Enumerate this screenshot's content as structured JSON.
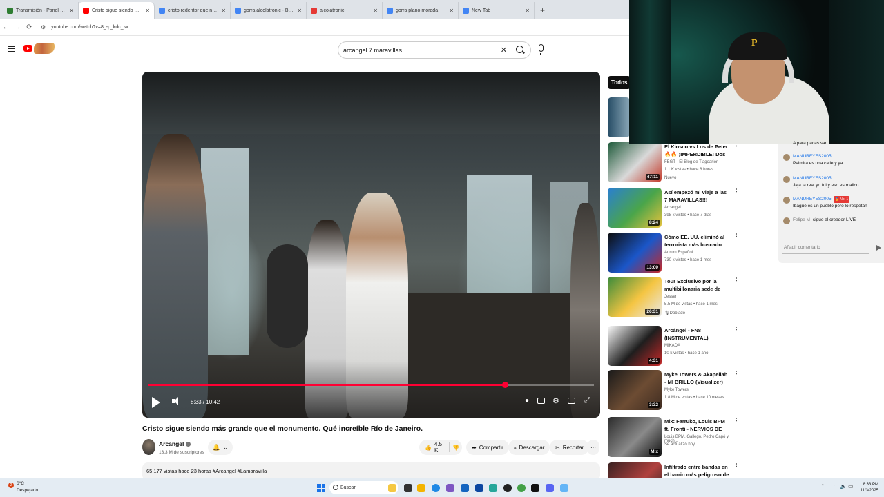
{
  "browser": {
    "tabs": [
      {
        "label": "Transmisión - Panel de control",
        "color": "#2e7d32",
        "active": false
      },
      {
        "label": "Cristo sigue siendo más gra",
        "color": "#ff0000",
        "active": true
      },
      {
        "label": "cristo redentor que numero de",
        "color": "#4285f4",
        "active": false
      },
      {
        "label": "gorra alcolatronic - Buscar con",
        "color": "#4285f4",
        "active": false
      },
      {
        "label": "alcolatronic",
        "color": "#e53935",
        "active": false
      },
      {
        "label": "gorra plano morada",
        "color": "#4285f4",
        "active": false
      },
      {
        "label": "New Tab",
        "color": "#4285f4",
        "active": false
      }
    ],
    "new_tab_symbol": "+",
    "url": "youtube.com/watch?v=8_-p_kdc_lw"
  },
  "header": {
    "search_query": "arcangel 7 maravillas"
  },
  "player": {
    "time": "8:33 / 10:42",
    "progress_fraction": 0.8
  },
  "video": {
    "title": "Cristo sigue siendo más grande que el monumento. Qué increíble Río de Janeiro.",
    "channel": "Arcangel",
    "subscribers": "13.3 M de suscriptores",
    "likes": "4.5 K",
    "share_label": "Compartir",
    "download_label": "Descargar",
    "clip_label": "Recortar",
    "more_label": "···",
    "description": "65,177 vistas  hace 23 horas  #Arcangel #Lamaravilla"
  },
  "sidebar": {
    "chip": "Todos",
    "items": [
      {
        "title": "El Kiosco vs Los de Peter 🔥🔥 ¡IMPERDIBLE! Dos ...",
        "channel": "FBGT - El Blog de Tiagoariori",
        "meta": "1.1 K vistas • hace 8 horas",
        "badge": "Nuevo",
        "duration": "47:11",
        "thumb": [
          "#1e5a3a",
          "#d9d9d9",
          "#c43a2a"
        ]
      },
      {
        "title": "Así empezó mi viaje a las 7 MARAVILLAS!!!",
        "channel": "Arcangel",
        "meta": "398 k vistas • hace 7 días",
        "badge": "",
        "duration": "8:24",
        "thumb": [
          "#2a7fd1",
          "#4aa54a",
          "#e7c23d"
        ]
      },
      {
        "title": "Cómo EE. UU. eliminó al terrorista más buscado del ...",
        "channel": "Aurum Español",
        "meta": "730 k vistas • hace 1 mes",
        "badge": "",
        "duration": "13:00",
        "thumb": [
          "#0d0d0d",
          "#1b57c9",
          "#c62828"
        ]
      },
      {
        "title": "Tour Exclusivo por la multibillonaria sede de Nike",
        "channel": "Jesser",
        "meta": "5.5 M de vistas • hace 1 mes",
        "badge": "🎙Doblado",
        "duration": "26:31",
        "thumb": [
          "#3b8b3b",
          "#f5c542",
          "#e9e9e9"
        ]
      },
      {
        "title": "Arcángel - FN8 (INSTRUMENTAL)",
        "channel": "MIKADA",
        "meta": "10 k vistas • hace 1 año",
        "badge": "",
        "duration": "4:31",
        "thumb": [
          "#fafafa",
          "#1e1e1e",
          "#c62828"
        ]
      },
      {
        "title": "Myke Towers & Akapellah - MI BRILLO (Visualizer)",
        "channel": "Myke Towers",
        "meta": "1.8 M de vistas • hace 10 meses",
        "badge": "",
        "duration": "3:32",
        "thumb": [
          "#1a1a1a",
          "#6d4c33",
          "#3e2c21"
        ]
      },
      {
        "title": "Mix: Farruko, Louis BPM ft. Fronti - NERVIOS DE ACERO ...",
        "channel": "Louis BPM, Gallego, Pedro Capó y much...",
        "meta": "Se actualizó hoy",
        "badge": "",
        "duration": "Mix",
        "thumb": [
          "#2b2b2b",
          "#8a8a8a",
          "#111111"
        ]
      },
      {
        "title": "Infiltrado entre bandas en el barrio más peligroso de Estad...",
        "channel": "",
        "meta": "",
        "badge": "",
        "duration": "",
        "thumb": [
          "#3a2222",
          "#b0413e",
          "#222222"
        ]
      }
    ]
  },
  "chat": {
    "top_partial": "A para pacas san Mateo",
    "messages": [
      {
        "user": "MANUREYES2005",
        "text": "Palmira es una calle y ya",
        "badge": ""
      },
      {
        "user": "MANUREYES2005",
        "text": "Jaja la real yo fui y eso es malico",
        "badge": ""
      },
      {
        "user": "MANUREYES2005",
        "text": "Ibagué es un pueblo pero lo respetan",
        "badge": "🏅 No. 1"
      },
      {
        "user": "Felipe M",
        "text": "sigue al creador LIVE",
        "badge": ""
      }
    ],
    "input_placeholder": "Añadir comentario"
  },
  "taskbar": {
    "temperature": "6°C",
    "weather": "Despejado",
    "weather_badge": "2",
    "search_label": "Buscar",
    "time": "8:33 PM",
    "date": "11/3/2025"
  }
}
